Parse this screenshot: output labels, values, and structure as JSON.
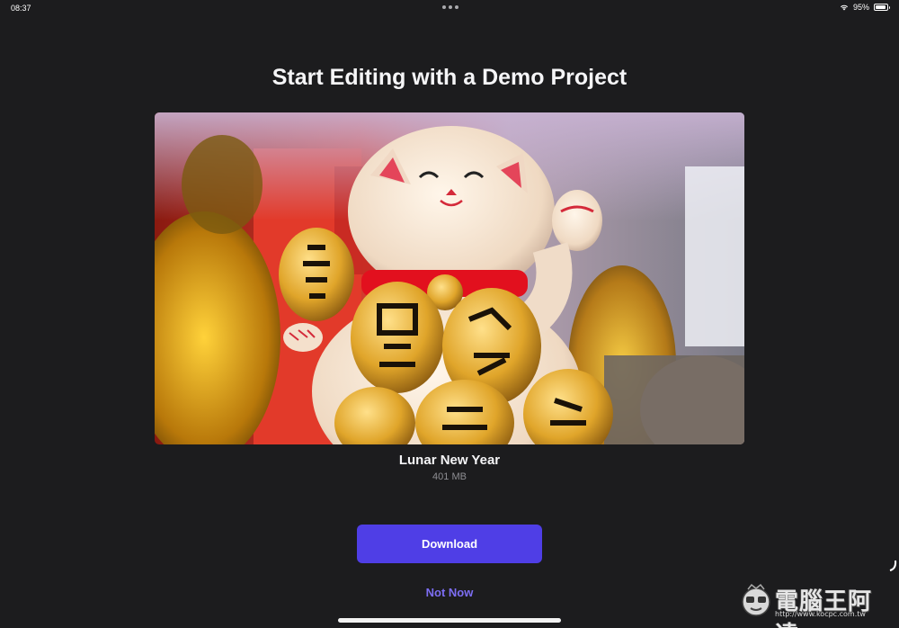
{
  "status_bar": {
    "time": "08:37",
    "battery_percent": "95%",
    "battery_level": 0.95,
    "icons": [
      "multitask-dots-icon",
      "wifi-icon",
      "battery-icon"
    ]
  },
  "title": "Start Editing with a Demo Project",
  "project": {
    "name": "Lunar New Year",
    "size": "401 MB",
    "thumbnail": "lucky-cat-photo"
  },
  "actions": {
    "download_label": "Download",
    "not_now_label": "Not Now"
  },
  "colors": {
    "background": "#1c1c1e",
    "accent": "#4f3ee6",
    "link": "#7d6ef5",
    "secondary_text": "#8e8e93"
  },
  "watermark": {
    "text": "電腦王阿達",
    "url": "http://www.kocpc.com.tw"
  }
}
